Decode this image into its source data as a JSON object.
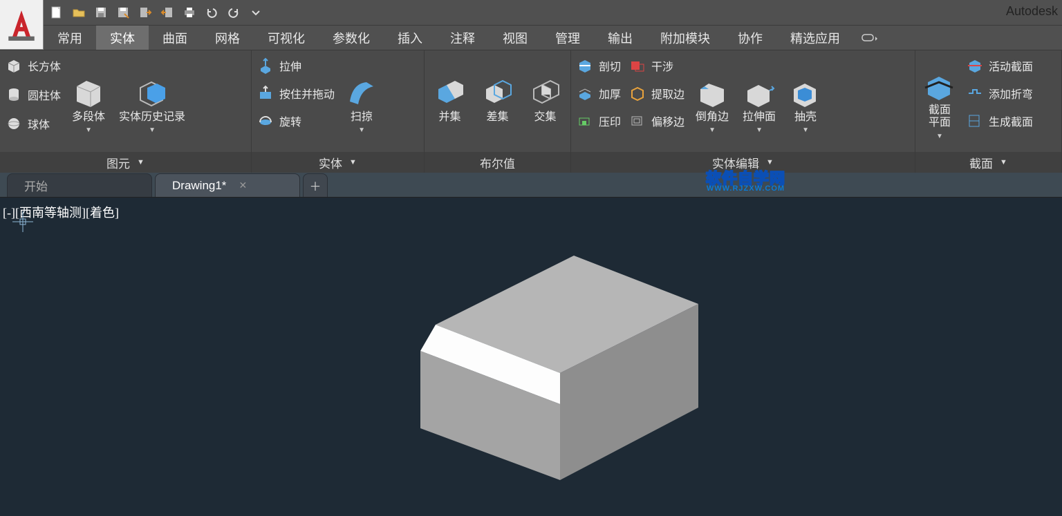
{
  "app": {
    "title_right": "Autodesk"
  },
  "menuTabs": {
    "items": [
      "常用",
      "实体",
      "曲面",
      "网格",
      "可视化",
      "参数化",
      "插入",
      "注释",
      "视图",
      "管理",
      "输出",
      "附加模块",
      "协作",
      "精选应用"
    ],
    "activeIndex": 1
  },
  "ribbon": {
    "panel_primitives": {
      "title": "图元",
      "box": "长方体",
      "cylinder": "圆柱体",
      "sphere": "球体",
      "polysolid": "多段体",
      "history": "实体历史记录"
    },
    "panel_solid": {
      "title": "实体",
      "extrude": "拉伸",
      "presspull": "按住并拖动",
      "revolve": "旋转",
      "sweep": "扫掠"
    },
    "panel_boolean": {
      "title": "布尔值",
      "union": "并集",
      "subtract": "差集",
      "intersect": "交集"
    },
    "panel_solidedit": {
      "title": "实体编辑",
      "slice": "剖切",
      "thicken": "加厚",
      "imprint": "压印",
      "interfere": "干涉",
      "extractedges": "提取边",
      "offsetedge": "偏移边",
      "chamfer": "倒角边",
      "extrudeface": "拉伸面",
      "shell": "抽壳"
    },
    "panel_section": {
      "title": "截面",
      "plane": "截面\n平面",
      "live": "活动截面",
      "jog": "添加折弯",
      "generate": "生成截面"
    }
  },
  "fileTabs": {
    "start": "开始",
    "drawing": "Drawing1*"
  },
  "viewport": {
    "status": "[-][西南等轴测][着色]"
  },
  "watermark": {
    "top": "软件自学网",
    "bottom": "WWW.RJZXW.COM"
  }
}
